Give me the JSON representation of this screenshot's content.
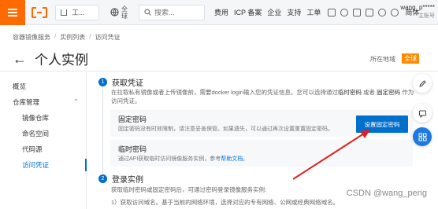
{
  "topbar": {
    "workspace": "工...",
    "region": "全\n球",
    "search_placeholder": "搜索...",
    "links": [
      "费用",
      "ICP 备案",
      "企业",
      "支持",
      "工单"
    ],
    "language": "简体",
    "user_name": "wang_p*****",
    "user_role": "主账号"
  },
  "breadcrumb": [
    "容器镜像服务",
    "实例列表",
    "访问凭证"
  ],
  "title": {
    "text": "个人实例",
    "region_label": "所在地域",
    "region_value": "全球"
  },
  "leftnav": {
    "overview": "概览",
    "group": "仓库管理",
    "items": [
      "镜像仓库",
      "命名空间",
      "代码源",
      "访问凭证"
    ]
  },
  "steps": [
    {
      "num": "1",
      "title": "获取凭证",
      "desc_prefix": "在拉取私有镜像或者上传镜像前，需要docker login输入您的凭证信息。您可以选择通过",
      "desc_k1": "临时密码",
      "desc_or": "或者",
      "desc_k2": "固定密码",
      "desc_suffix": "作为访问凭证。"
    },
    {
      "num": "2",
      "title": "登录实例",
      "desc": "获取临时密码或固定密码后，可通过密码登录镜像服务实例:",
      "desc2": "1）获取访问域名。基于当前的网络环境，选择对应的专有网络、公网或经典网络域名。"
    }
  ],
  "fixed_password": {
    "title": "固定密码",
    "desc": "固定密码没有时效限制，请注意妥善保管。如果遗失，可以通过再次设置重置固定密码。",
    "button": "设置固定密码"
  },
  "temp_password": {
    "title": "临时密码",
    "desc_prefix": "通过API获取临时访问镜像服务实例，参考",
    "link": "帮助文档",
    "desc_suffix": "。"
  },
  "watermark": "CSDN @wang_peng",
  "colors": {
    "brand": "#ff6a00",
    "primary": "#0070cc",
    "arrow": "#e02020"
  }
}
